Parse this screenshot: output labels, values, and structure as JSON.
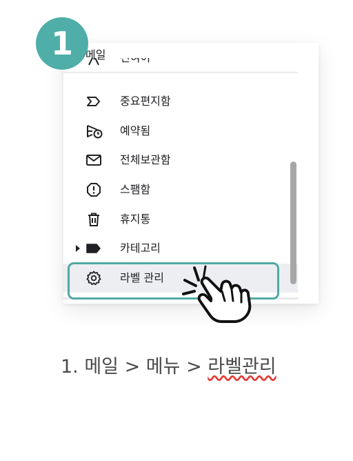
{
  "step": {
    "number": "1"
  },
  "panel": {
    "title": "메일",
    "items": [
      {
        "label": "전혀이",
        "icon": "send-icon",
        "partial": true
      },
      {
        "label": "중요편지함",
        "icon": "important-icon"
      },
      {
        "label": "예약됨",
        "icon": "scheduled-send-icon"
      },
      {
        "label": "전체보관함",
        "icon": "mail-icon"
      },
      {
        "label": "스팸함",
        "icon": "report-spam-icon"
      },
      {
        "label": "휴지통",
        "icon": "trash-icon"
      },
      {
        "label": "카테고리",
        "icon": "label-icon",
        "expandable": true
      },
      {
        "label": "라벨 관리",
        "icon": "settings-icon",
        "active": true
      }
    ]
  },
  "caption": {
    "prefix": "1. 메일 > 메뉴 > ",
    "highlighted": "라벨관리"
  },
  "colors": {
    "accent": "#4faea7",
    "highlight_border": "#4fa9a4",
    "active_row": "#eceef1",
    "spellcheck_underline": "#e53935"
  }
}
